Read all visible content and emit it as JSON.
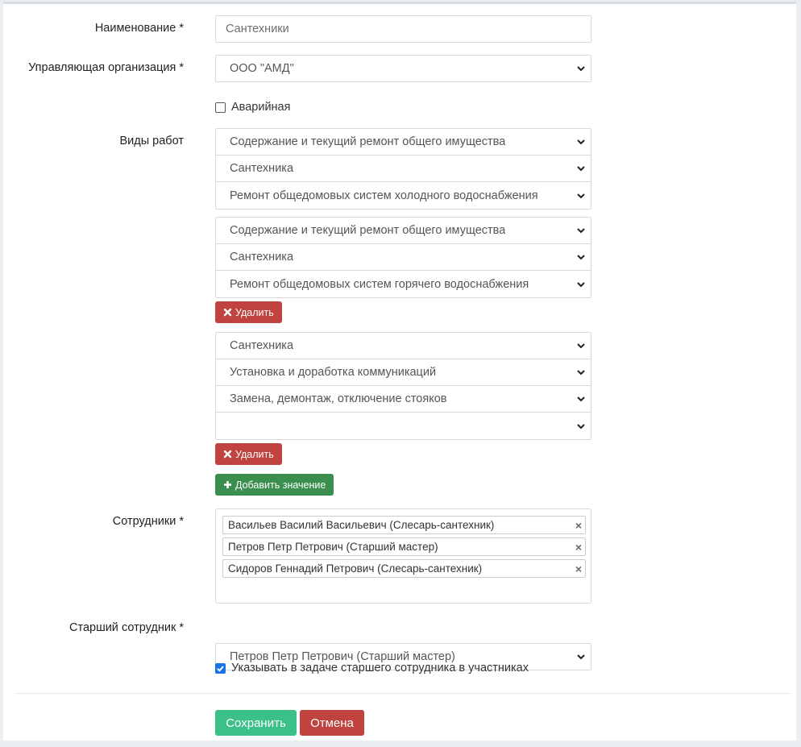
{
  "form": {
    "name": {
      "label": "Наименование *",
      "value": "Сантехники"
    },
    "org": {
      "label": "Управляющая организация *",
      "value": "ООО \"АМД\""
    },
    "emergency": {
      "label": "Аварийная",
      "checked": false
    },
    "work_types": {
      "label": "Виды работ",
      "groups": [
        {
          "selects": [
            "Содержание и текущий ремонт общего имущества",
            "Сантехника",
            "Ремонт общедомовых систем холодного водоснабжения"
          ]
        },
        {
          "selects": [
            "Содержание и текущий ремонт общего имущества",
            "Сантехника",
            "Ремонт общедомовых систем горячего водоснабжения"
          ],
          "delete_label": "Удалить"
        },
        {
          "selects": [
            "Сантехника",
            "Установка и доработка коммуникаций",
            "Замена, демонтаж, отключение стояков",
            ""
          ],
          "delete_label": "Удалить"
        }
      ],
      "add_label": "Добавить значение"
    },
    "employees": {
      "label": "Сотрудники *",
      "tags": [
        "Васильев Василий Васильевич (Слесарь-сантехник)",
        "Петров Петр Петрович (Старший мастер)",
        "Сидоров Геннадий Петрович (Слесарь-сантехник)"
      ]
    },
    "senior": {
      "label": "Старший сотрудник *",
      "value": "Петров Петр Петрович (Старший мастер)"
    },
    "include_senior": {
      "label": "Указывать в задаче старшего сотрудника в участниках",
      "checked": true
    },
    "save_label": "Сохранить",
    "cancel_label": "Отмена"
  },
  "colors": {
    "delete": "#c0433f",
    "add": "#3a8f4f",
    "save": "#3cc08a",
    "cancel": "#c0433f",
    "checkbox": "#1a73e8"
  },
  "icons": {
    "select_arrow": "chevron-down-icon",
    "delete": "x-icon",
    "add": "plus-icon",
    "tag_remove": "close-icon"
  }
}
